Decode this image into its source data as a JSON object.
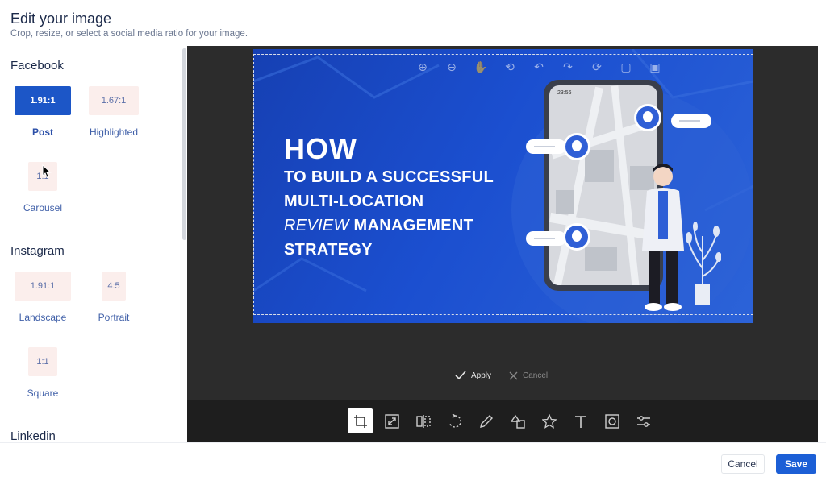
{
  "header": {
    "title": "Edit your image",
    "subtitle": "Crop, resize, or select a social media ratio for your image."
  },
  "sidebar": {
    "groups": [
      {
        "title": "Facebook",
        "items": [
          {
            "ratio": "1.91:1",
            "label": "Post",
            "active": true
          },
          {
            "ratio": "1.67:1",
            "label": "Highlighted",
            "active": false
          },
          {
            "ratio": "1:1",
            "label": "Carousel",
            "active": false
          }
        ]
      },
      {
        "title": "Instagram",
        "items": [
          {
            "ratio": "1.91:1",
            "label": "Landscape",
            "active": false
          },
          {
            "ratio": "4:5",
            "label": "Portrait",
            "active": false
          },
          {
            "ratio": "1:1",
            "label": "Square",
            "active": false
          }
        ]
      },
      {
        "title": "Linkedin",
        "items": []
      }
    ]
  },
  "canvas": {
    "headline_line1": "HOW",
    "headline_line2": "TO BUILD A SUCCESSFUL",
    "headline_line3": "MULTI-LOCATION",
    "headline_line4_italic": "REVIEW",
    "headline_line4_rest": " MANAGEMENT",
    "headline_line5": "STRATEGY",
    "phone_time": "23:56",
    "top_tools": [
      "zoom-in-icon",
      "zoom-out-icon",
      "pan-hand-icon",
      "history-icon",
      "undo-icon",
      "redo-icon",
      "reset-icon",
      "delete-icon",
      "delete-all-icon"
    ]
  },
  "actions": {
    "apply_label": "Apply",
    "cancel_label": "Cancel"
  },
  "toolbar": {
    "tools": [
      "crop-icon",
      "resize-icon",
      "flip-icon",
      "rotate-icon",
      "draw-icon",
      "shape-icon",
      "icon-star-icon",
      "text-icon",
      "mask-icon",
      "filter-icon"
    ],
    "active_tool": "crop-icon"
  },
  "footer": {
    "cancel_label": "Cancel",
    "save_label": "Save"
  },
  "colors": {
    "accent": "#1c5fd6",
    "active_ratio": "#1c56c7",
    "ratio_bg": "#fbeeec",
    "editor_bg": "#2c2c2c",
    "toolbar_bg": "#1e1e1e"
  }
}
